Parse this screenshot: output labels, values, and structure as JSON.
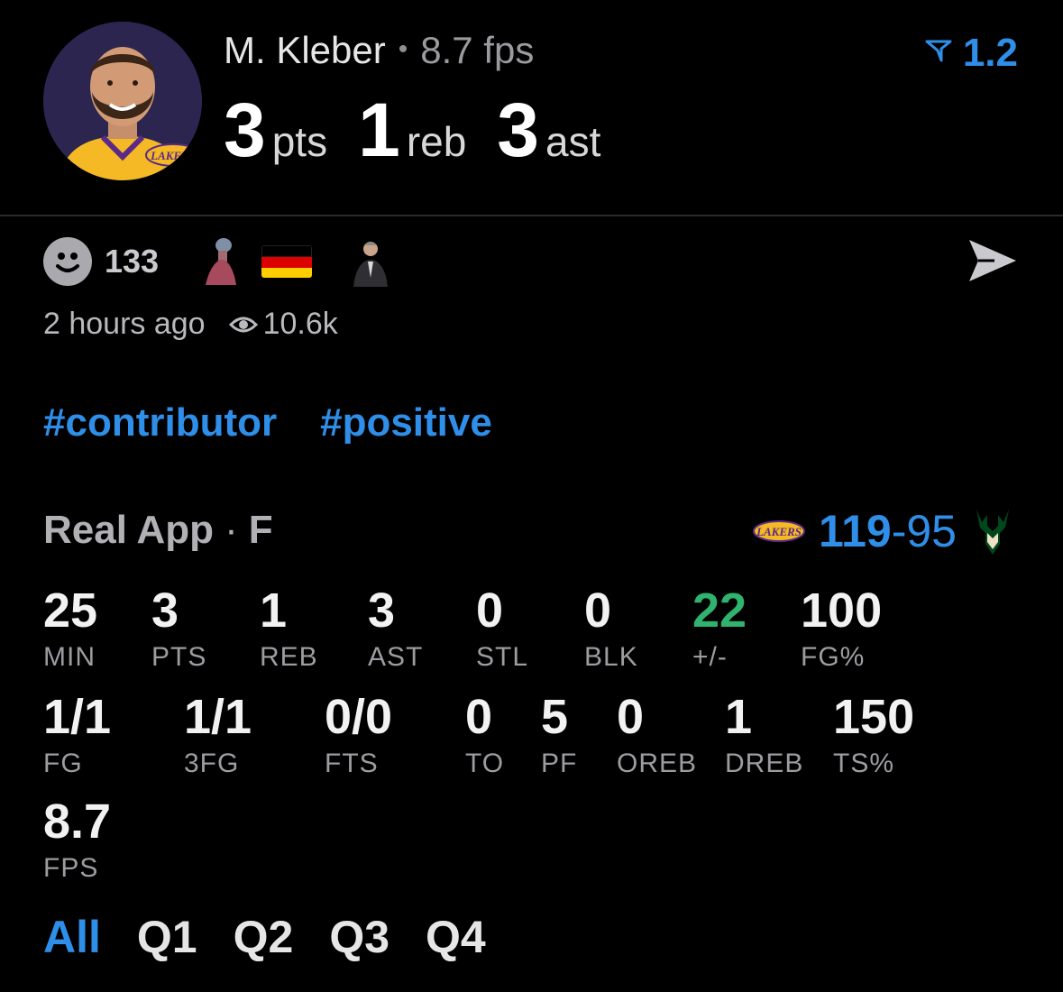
{
  "player": {
    "name": "M. Kleber",
    "fps_label": "8.7 fps",
    "avatar_team": "LAKERS"
  },
  "statline": [
    {
      "value": "3",
      "label": "pts"
    },
    {
      "value": "1",
      "label": "reb"
    },
    {
      "value": "3",
      "label": "ast"
    }
  ],
  "rating": "1.2",
  "reactions": {
    "count": "133"
  },
  "meta": {
    "time": "2 hours ago",
    "views": "10.6k"
  },
  "tags": [
    "#contributor",
    "#positive"
  ],
  "game": {
    "source": "Real App",
    "status": "F",
    "home_team": "LAKERS",
    "home_score": "119",
    "away_score": "95"
  },
  "stats_row1": [
    {
      "value": "25",
      "label": "MIN"
    },
    {
      "value": "3",
      "label": "PTS"
    },
    {
      "value": "1",
      "label": "REB"
    },
    {
      "value": "3",
      "label": "AST"
    },
    {
      "value": "0",
      "label": "STL"
    },
    {
      "value": "0",
      "label": "BLK"
    },
    {
      "value": "22",
      "label": "+/-"
    },
    {
      "value": "100",
      "label": "FG%"
    }
  ],
  "stats_row2": [
    {
      "value": "1/1",
      "label": "FG"
    },
    {
      "value": "1/1",
      "label": "3FG"
    },
    {
      "value": "0/0",
      "label": "FTS"
    },
    {
      "value": "0",
      "label": "TO"
    },
    {
      "value": "5",
      "label": "PF"
    },
    {
      "value": "0",
      "label": "OREB"
    },
    {
      "value": "1",
      "label": "DREB"
    },
    {
      "value": "150",
      "label": "TS%"
    }
  ],
  "stats_row3": [
    {
      "value": "8.7",
      "label": "FPS"
    }
  ],
  "tabs": [
    "All",
    "Q1",
    "Q2",
    "Q3",
    "Q4"
  ],
  "colors": {
    "accent": "#2f8fe8",
    "positive": "#2fb36e",
    "lakers_purple": "#552583",
    "lakers_gold": "#FDB927",
    "bucks_green": "#00471B"
  }
}
